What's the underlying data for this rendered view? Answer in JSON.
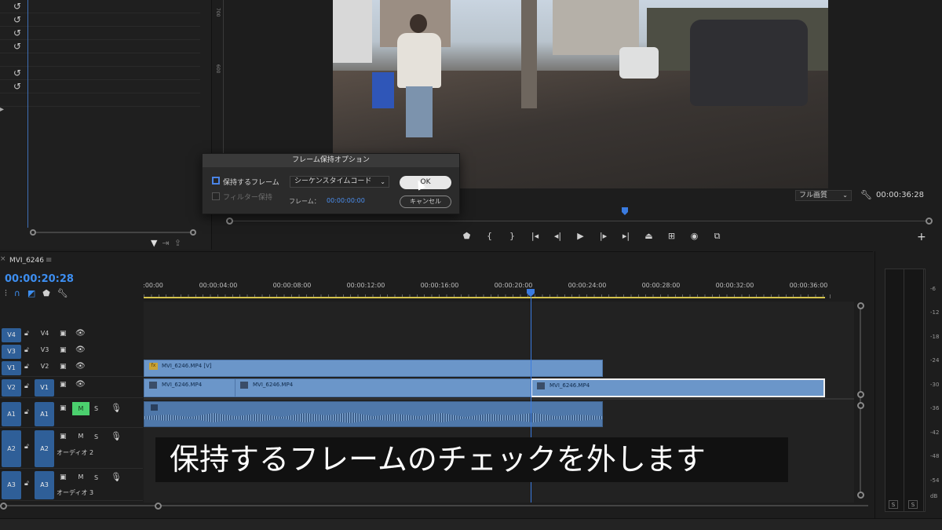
{
  "left_panel": {
    "undo_icon": "undo-icon",
    "rows": [
      "↺",
      "↺",
      "↺",
      "↺",
      "",
      "↺",
      "↺"
    ]
  },
  "monitor": {
    "ruler_ticks": [
      "700",
      "600"
    ],
    "quality": "フル画質",
    "timecode": "00:00:36:28",
    "transport_icons": [
      "marker-icon",
      "in-point-icon",
      "out-point-icon",
      "go-to-in-icon",
      "step-back-icon",
      "play-icon",
      "step-forward-icon",
      "go-to-out-icon",
      "lift-icon",
      "extract-icon",
      "export-frame-icon",
      "compare-icon"
    ]
  },
  "dialog": {
    "title": "フレーム保持オプション",
    "hold_frame_label": "保持するフレーム",
    "filter_label": "フィルター保持",
    "source_select": "シーケンスタイムコード",
    "frame_label": "フレーム：",
    "frame_value": "00:00:00:00",
    "ok": "OK",
    "cancel": "キャンセル"
  },
  "timeline": {
    "sequence_name": "MVI_6246",
    "timecode": "00:00:20:28",
    "ruler_labels": [
      ":00:00",
      "00:00:04:00",
      "00:00:08:00",
      "00:00:12:00",
      "00:00:16:00",
      "00:00:20:00",
      "00:00:24:00",
      "00:00:28:00",
      "00:00:32:00",
      "00:00:36:00"
    ],
    "video_tracks": [
      {
        "src": "V4",
        "name": "V4"
      },
      {
        "src": "V3",
        "name": "V3"
      },
      {
        "src": "V1",
        "name": "V2"
      },
      {
        "src": "V2",
        "name": "V1"
      }
    ],
    "audio_tracks": [
      {
        "src": "A1",
        "name": "A1",
        "label": "",
        "mute": "M",
        "solo": "S"
      },
      {
        "src": "A2",
        "name": "A2",
        "label": "オーディオ 2",
        "mute": "M",
        "solo": "S"
      },
      {
        "src": "A3",
        "name": "A3",
        "label": "オーディオ 3",
        "mute": "M",
        "solo": "S"
      }
    ],
    "clips": {
      "v2_clip": "MVI_6246.MP4 [V]",
      "fx_badge": "fx",
      "v1_clip_a": "MVI_6246.MP4",
      "v1_clip_b": "MVI_6246.MP4",
      "v1_clip_c": "MVI_6246.MP4"
    }
  },
  "subtitle": "保持するフレームのチェックを外します",
  "meter": {
    "db_labels": [
      "-6",
      "-12",
      "-18",
      "-24",
      "-30",
      "-36",
      "-42",
      "-48",
      "-54",
      "dB"
    ],
    "solo_left": "S",
    "solo_right": "S"
  },
  "colors": {
    "accent_blue": "#3d8ef0",
    "clip_blue": "#6b96c9",
    "mute_green": "#4bd06e",
    "workbar_yellow": "#d4c34c"
  }
}
